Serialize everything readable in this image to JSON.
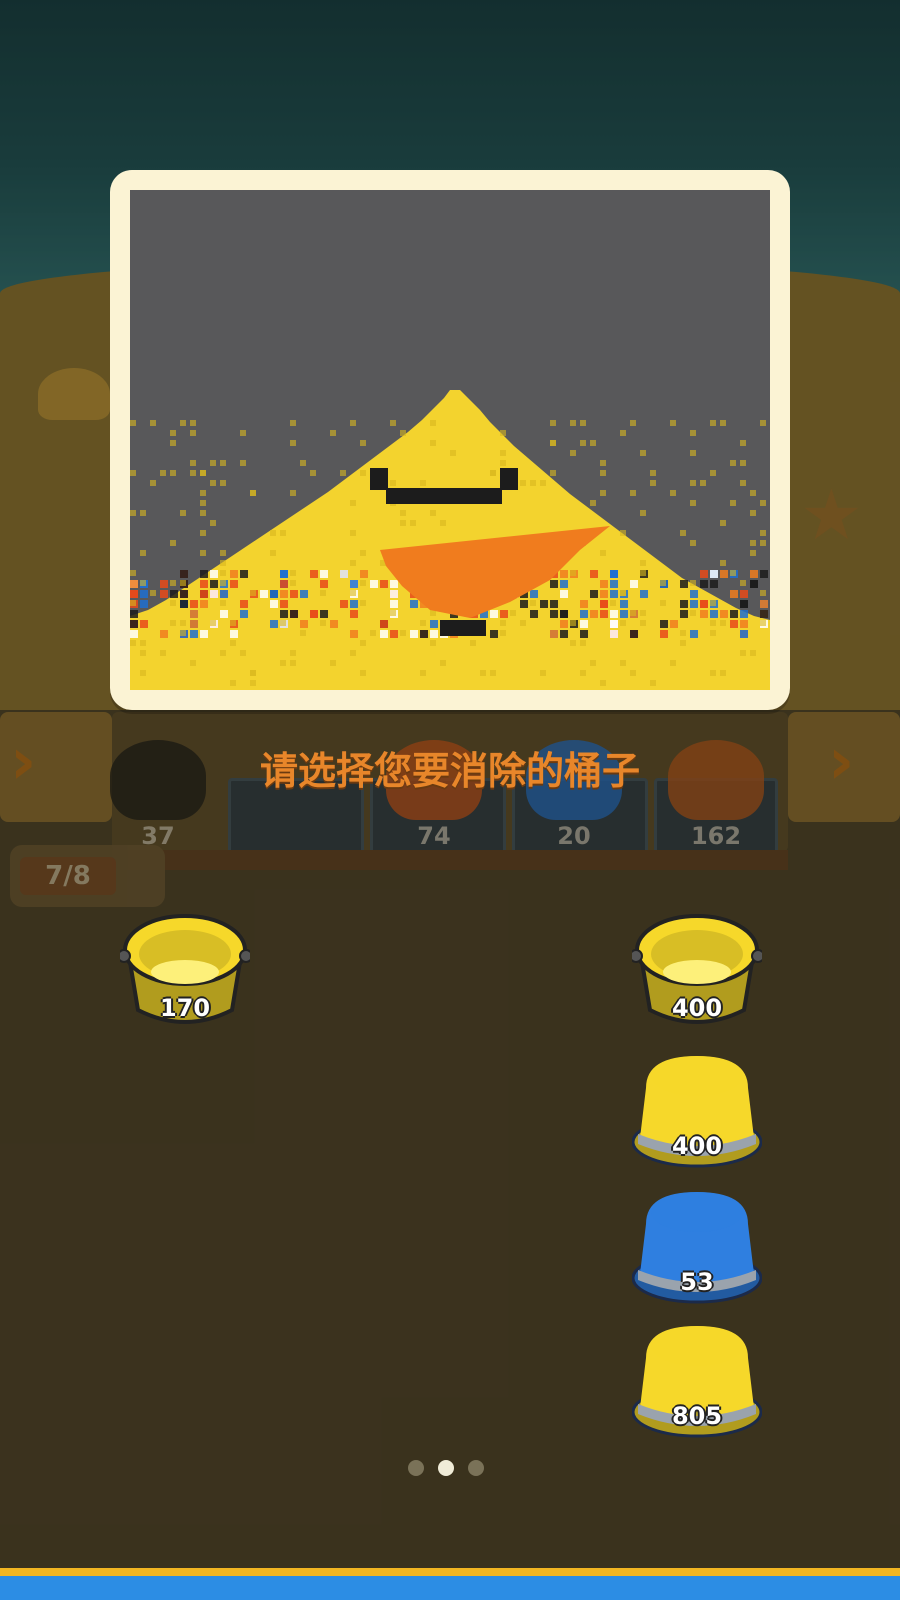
{
  "prompt_text": "请选择您要消除的桶子",
  "progress": {
    "label": "7/8",
    "current": 7,
    "total": 8
  },
  "belt_buckets": [
    {
      "color": "#1a1a1a",
      "count": "37"
    },
    {
      "color": "#c9541a",
      "count": "74"
    },
    {
      "color": "#1f6fd0",
      "count": "20"
    },
    {
      "color": "#b8561c",
      "count": "162"
    }
  ],
  "left_buckets": [
    {
      "color": "#f6d82a",
      "count": "170",
      "state": "open"
    }
  ],
  "right_buckets": [
    {
      "color": "#f6d82a",
      "count": "400",
      "state": "open"
    },
    {
      "color": "#f6d82a",
      "count": "400",
      "state": "closed"
    },
    {
      "color": "#2f7fe0",
      "count": "53",
      "state": "closed"
    },
    {
      "color": "#f6d82a",
      "count": "805",
      "state": "closed"
    }
  ],
  "page_indicator": {
    "pages": 3,
    "active": 2
  },
  "icons": {
    "left_arrow": "chevron-right-icon",
    "right_arrow": "chevron-right-icon"
  },
  "colors": {
    "sand_yellow": "#f3d32e",
    "panel_frame": "#fbf3d4",
    "panel_bg": "#58585a",
    "prompt_orange": "#e8862a",
    "bottom_bar": "#2c8de4",
    "bottom_bar_trim": "#f2b622"
  }
}
